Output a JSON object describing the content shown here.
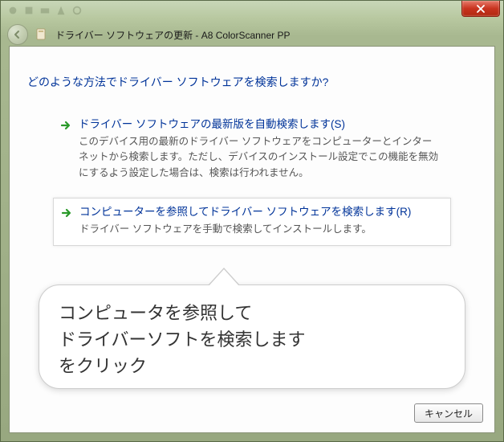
{
  "titlebar": {
    "close_label": "Close"
  },
  "header": {
    "title": "ドライバー ソフトウェアの更新 - A8 ColorScanner PP"
  },
  "main": {
    "question": "どのような方法でドライバー ソフトウェアを検索しますか?",
    "options": [
      {
        "title": "ドライバー ソフトウェアの最新版を自動検索します(S)",
        "desc": "このデバイス用の最新のドライバー ソフトウェアをコンピューターとインターネットから検索します。ただし、デバイスのインストール設定でこの機能を無効にするよう設定した場合は、検索は行われません。"
      },
      {
        "title": "コンピューターを参照してドライバー ソフトウェアを検索します(R)",
        "desc": "ドライバー ソフトウェアを手動で検索してインストールします。"
      }
    ],
    "cancel_label": "キャンセル"
  },
  "callout": {
    "line1": "コンピュータを参照して",
    "line2": "ドライバーソフトを検索します",
    "line3": "をクリック"
  }
}
